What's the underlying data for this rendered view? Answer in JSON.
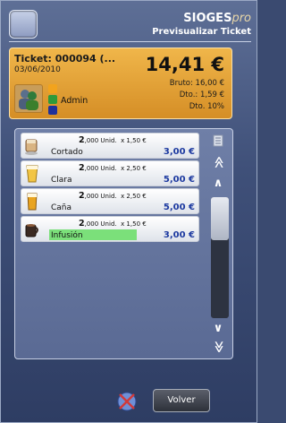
{
  "header": {
    "brand": "SIOGES",
    "brand_suffix": "pro",
    "subtitle": "Previsualizar Ticket"
  },
  "ticket": {
    "number": "Ticket: 000094 (...",
    "date": "03/06/2010",
    "total": "14,41 €",
    "bruto": "Bruto: 16,00 €",
    "dto": "Dto.: 1,59 €",
    "dto_pct": "Dto. 10%",
    "user": "Admin",
    "swatch_colors": [
      "#f2a31d",
      "#2e9a3a",
      "#1f2f9a"
    ]
  },
  "items": [
    {
      "qty": "2",
      "qty_suffix": ",000 Unid.",
      "unit_price": "x 1,50 €",
      "name": "Cortado",
      "price": "3,00 €",
      "icon": "coffee-cup-icon"
    },
    {
      "qty": "2",
      "qty_suffix": ",000 Unid.",
      "unit_price": "x 2,50 €",
      "name": "Clara",
      "price": "5,00 €",
      "icon": "beer-glass-icon"
    },
    {
      "qty": "2",
      "qty_suffix": ",000 Unid.",
      "unit_price": "x 2,50 €",
      "name": "Caña",
      "price": "5,00 €",
      "icon": "beer-glass-icon"
    },
    {
      "qty": "2",
      "qty_suffix": ",000 Unid.",
      "unit_price": "x 1,50 €",
      "name": "Infusión",
      "price": "3,00 €",
      "icon": "tea-mug-icon"
    }
  ],
  "scroll": {
    "top_icon": "list-icon",
    "up_fast": "≪",
    "up": "∧",
    "down": "∨",
    "down_fast": "≫"
  },
  "footer": {
    "volver_label": "Volver"
  }
}
